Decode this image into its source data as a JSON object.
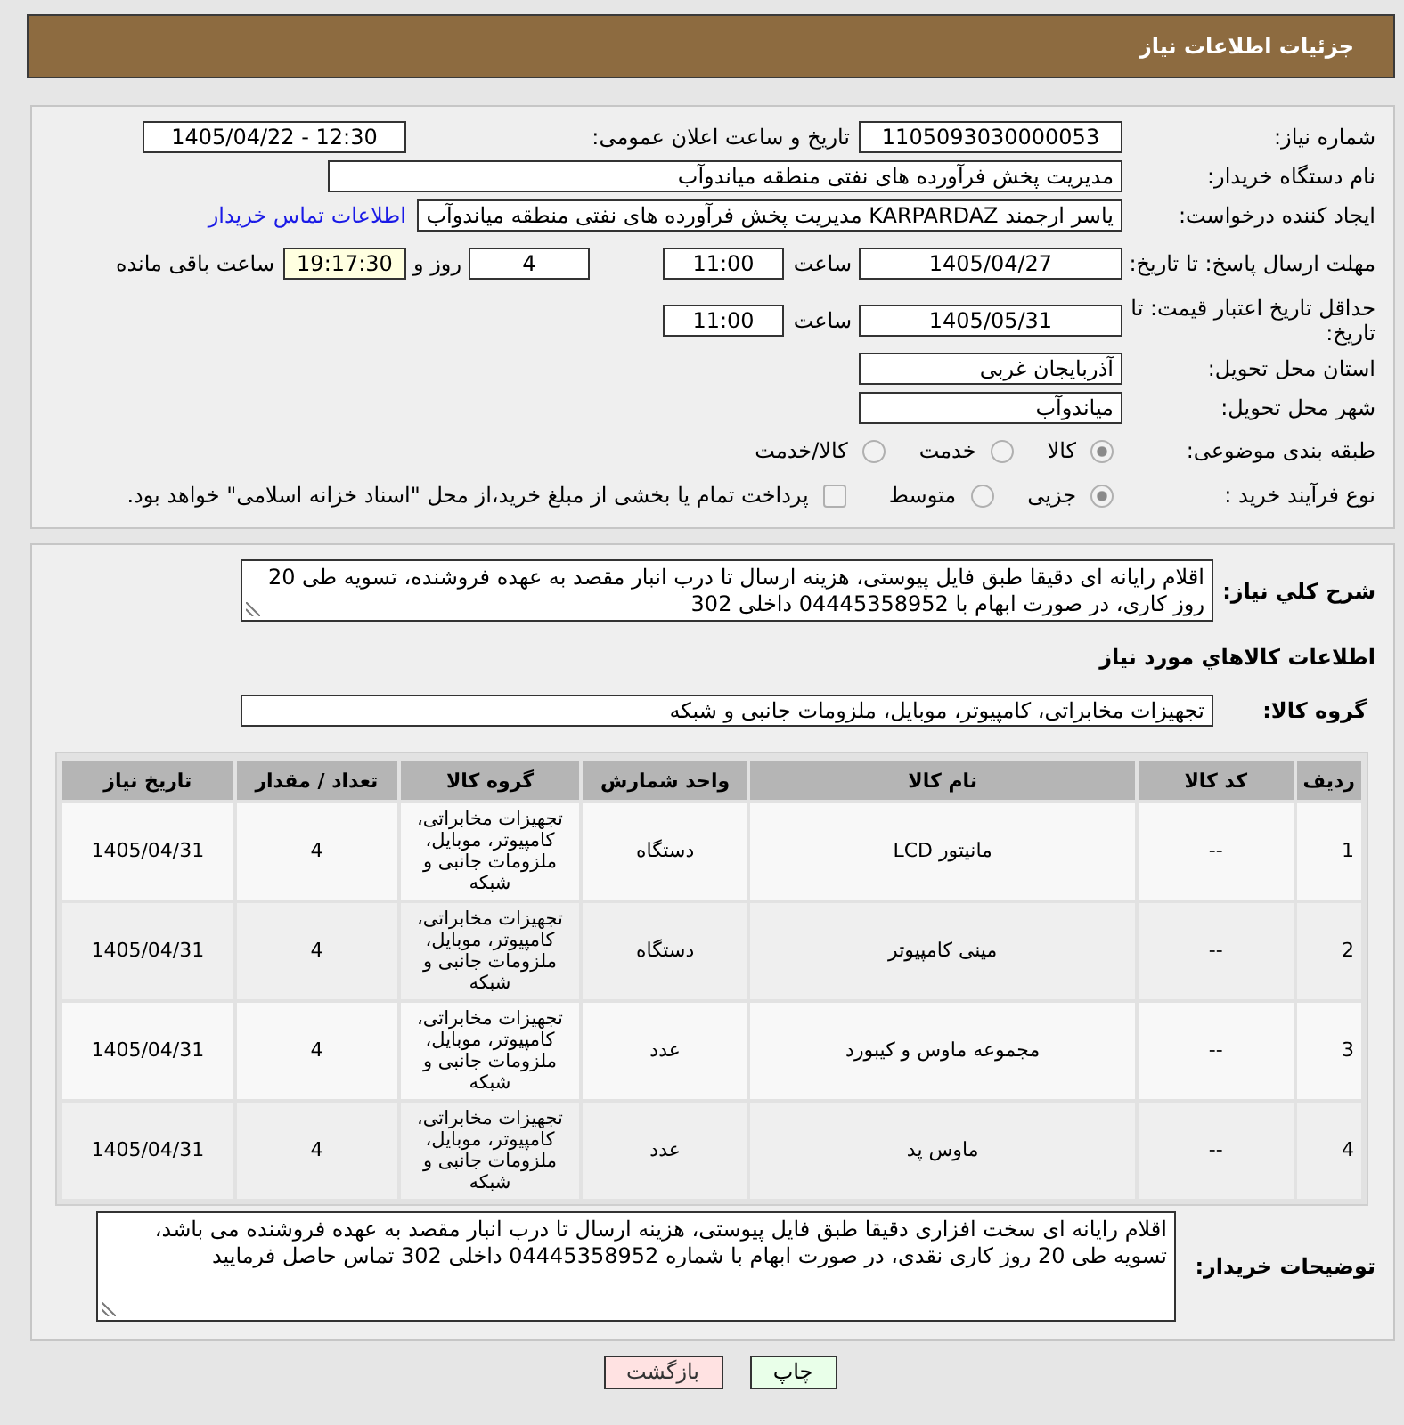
{
  "header": {
    "title": "جزئیات اطلاعات نیاز"
  },
  "details": {
    "need_number": {
      "label": "شماره نیاز:",
      "value": "1105093030000053"
    },
    "announcement": {
      "label": "تاریخ و ساعت اعلان عمومی:",
      "value": "1405/04/22 - 12:30"
    },
    "buyer_org": {
      "label": "نام دستگاه خریدار:",
      "value": "مدیریت پخش فرآورده های نفتی منطقه میاندوآب"
    },
    "requester": {
      "label": "ایجاد کننده درخواست:",
      "value": "یاسر ارجمند KARPARDAZ مدیریت پخش فرآورده های نفتی منطقه میاندوآب",
      "link": "اطلاعات تماس خریدار"
    },
    "reply_deadline": {
      "label": "مهلت ارسال پاسخ: تا تاریخ:",
      "date": "1405/04/27",
      "time_label": "ساعت",
      "time": "11:00",
      "days": "4",
      "days_label": "روز و",
      "remaining": "19:17:30",
      "remaining_label": "ساعت باقی مانده"
    },
    "price_validity": {
      "label": "حداقل تاریخ اعتبار قیمت: تا تاریخ:",
      "date": "1405/05/31",
      "time_label": "ساعت",
      "time": "11:00"
    },
    "province": {
      "label": "استان محل تحویل:",
      "value": "آذربایجان غربی"
    },
    "city": {
      "label": "شهر محل تحویل:",
      "value": "میاندوآب"
    },
    "category": {
      "label": "طبقه بندی موضوعی:",
      "options": [
        {
          "label": "کالا",
          "selected": true
        },
        {
          "label": "خدمت",
          "selected": false
        },
        {
          "label": "کالا/خدمت",
          "selected": false
        }
      ]
    },
    "purchase_type": {
      "label": "نوع فرآیند خرید :",
      "options": [
        {
          "label": "جزیی",
          "selected": true
        },
        {
          "label": "متوسط",
          "selected": false
        }
      ],
      "treasury": {
        "label": "پرداخت تمام یا بخشی از مبلغ خرید،از محل \"اسناد خزانه اسلامی\" خواهد بود.",
        "checked": false
      }
    }
  },
  "needs": {
    "description": {
      "label": "شرح کلي نیاز:",
      "value": "اقلام رایانه ای دقیقا طبق فایل پیوستی، هزینه ارسال تا درب انبار مقصد به عهده فروشنده، تسویه طی 20 روز کاری، در صورت ابهام با 04445358952 داخلی 302"
    },
    "goods_title": "اطلاعات کالاهاي مورد نیاز",
    "goods_group": {
      "label": "گروه کالا:",
      "value": "تجهیزات مخابراتی، کامپیوتر، موبایل، ملزومات جانبی و شبکه"
    },
    "table": {
      "columns": [
        "ردیف",
        "کد کالا",
        "نام کالا",
        "واحد شمارش",
        "گروه کالا",
        "تعداد / مقدار",
        "تاریخ نیاز"
      ],
      "rows": [
        [
          "1",
          "--",
          "مانیتور LCD",
          "دستگاه",
          "تجهیزات مخابراتی، کامپیوتر، موبایل، ملزومات جانبی و شبکه",
          "4",
          "1405/04/31"
        ],
        [
          "2",
          "--",
          "مینی کامپیوتر",
          "دستگاه",
          "تجهیزات مخابراتی، کامپیوتر، موبایل، ملزومات جانبی و شبکه",
          "4",
          "1405/04/31"
        ],
        [
          "3",
          "--",
          "مجموعه ماوس و کیبورد",
          "عدد",
          "تجهیزات مخابراتی، کامپیوتر، موبایل، ملزومات جانبی و شبکه",
          "4",
          "1405/04/31"
        ],
        [
          "4",
          "--",
          "ماوس پد",
          "عدد",
          "تجهیزات مخابراتی، کامپیوتر، موبایل، ملزومات جانبی و شبکه",
          "4",
          "1405/04/31"
        ]
      ]
    },
    "buyer_notes": {
      "label": "توضیحات خریدار:",
      "value": "اقلام رایانه ای سخت افزاری دقیقا طبق فایل پیوستی، هزینه ارسال تا درب انبار مقصد به عهده فروشنده می باشد، تسویه طی 20 روز کاری نقدی، در صورت ابهام با شماره 04445358952 داخلی 302 تماس حاصل فرمایید"
    }
  },
  "buttons": [
    {
      "label": "چاپ",
      "kind": "print"
    },
    {
      "label": "بازگشت",
      "kind": "back"
    }
  ]
}
